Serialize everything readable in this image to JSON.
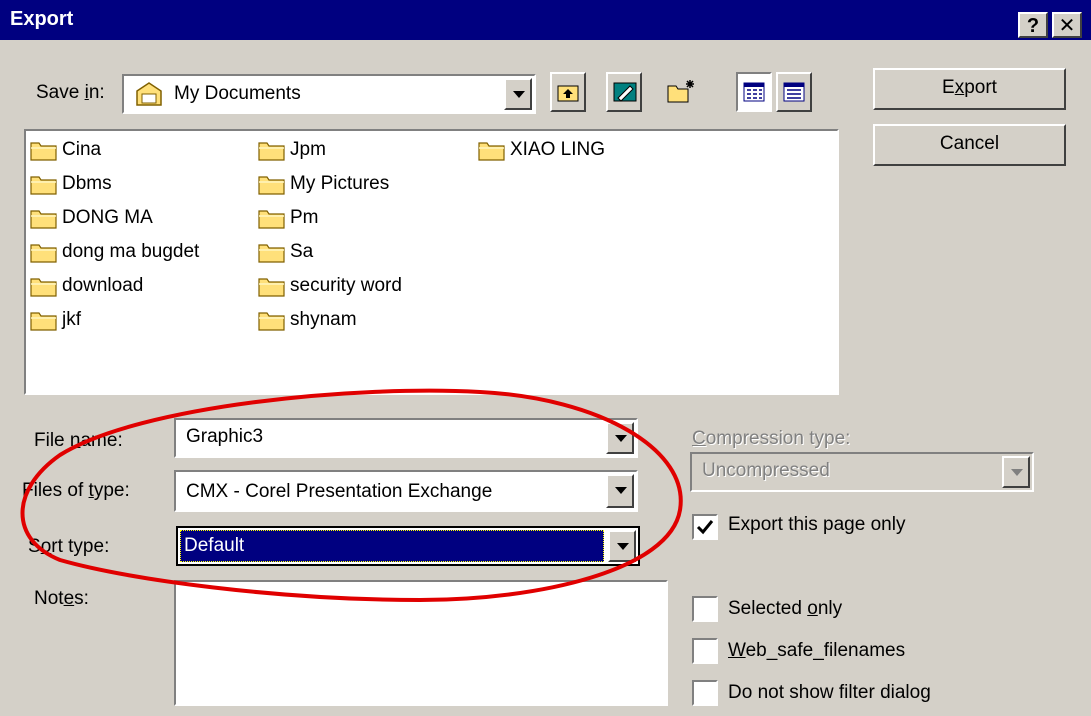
{
  "window": {
    "title": "Export",
    "help_label": "?",
    "close_label": "✕"
  },
  "save_in": {
    "label": "Save in:",
    "value": "My Documents"
  },
  "toolbar": {
    "icons": [
      "up-one-level-icon",
      "desktop-icon",
      "new-folder-icon",
      "list-view-icon",
      "details-view-icon"
    ]
  },
  "buttons": {
    "export_label": "Export",
    "cancel_label": "Cancel"
  },
  "files": {
    "columns": [
      [
        "Cina",
        "Dbms",
        "DONG MA",
        "dong ma bugdet",
        "download",
        "jkf"
      ],
      [
        "Jpm",
        "My Pictures",
        "Pm",
        "Sa",
        "security word",
        "shynam"
      ],
      [
        "XIAO LING"
      ]
    ]
  },
  "form": {
    "file_name_label": "File name:",
    "file_name_value": "Graphic3",
    "files_of_type_label": "Files of type:",
    "files_of_type_value": "CMX - Corel Presentation Exchange",
    "sort_type_label": "Sort type:",
    "sort_type_value": "Default",
    "notes_label": "Notes:",
    "compression_label": "Compression type:",
    "compression_value": "Uncompressed"
  },
  "options": {
    "export_page_only": {
      "label": "Export this page only",
      "checked": true
    },
    "selected_only": {
      "label": "Selected only",
      "checked": false
    },
    "web_safe": {
      "label": "Web_safe_filenames",
      "checked": false
    },
    "no_filter_dialog": {
      "label": "Do not show filter dialog",
      "checked": false
    }
  },
  "colors": {
    "titlebar": "#000080",
    "dialog_bg": "#d4d0c8",
    "highlight": "#000080",
    "annotation": "#e00000",
    "folder": "#ffe07a"
  }
}
